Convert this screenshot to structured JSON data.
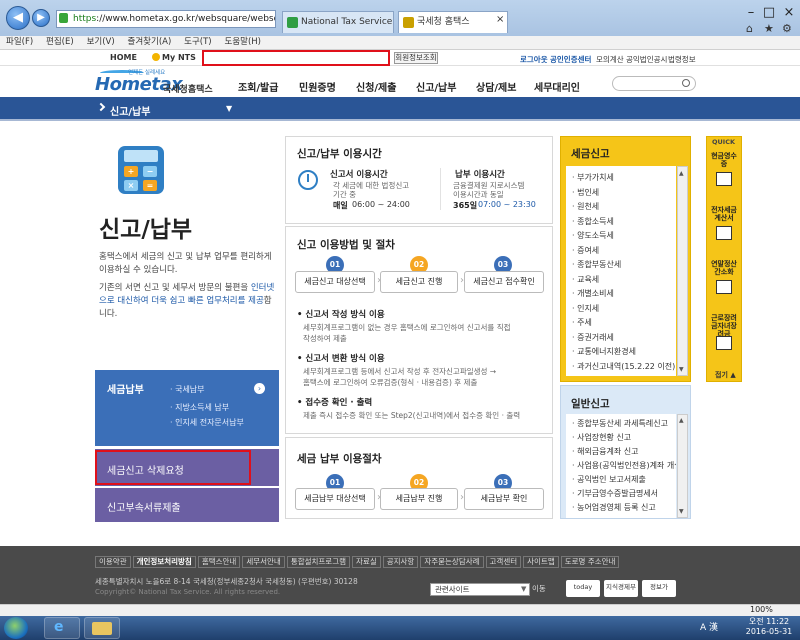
{
  "browser": {
    "url": "https://www.hometax.go.kr/websquare/websquare.wq?w2xPath=",
    "url_https": "https",
    "url_rest": "://www.hometax.go.kr/websquare/websquare.wq?w2xl",
    "tab1": "National Tax Service [KR]",
    "tab2": "국세청 홈택스",
    "menu": [
      "파일(F)",
      "편집(E)",
      "보기(V)",
      "즐겨찾기(A)",
      "도구(T)",
      "도움말(H)"
    ],
    "zoom": "100%"
  },
  "utility": {
    "home": "HOME",
    "mynts": "My NTS",
    "search_btn": "회원정보조회",
    "right": [
      "로그아웃",
      "공인인증센터",
      "모의계산",
      "공익법인공시",
      "법령정보"
    ]
  },
  "header": {
    "logo_tagline": "언제든 실례세요",
    "logo_text": "Hometax",
    "logo_korean": "국세청홈택스",
    "nav": [
      "조회/발급",
      "민원증명",
      "신청/제출",
      "신고/납부",
      "상담/제보",
      "세무대리인"
    ]
  },
  "section": {
    "title": "신고/납부",
    "caret": "▼"
  },
  "left": {
    "title": "신고/납부",
    "desc1": "홈택스에서 세금의 신고 및 납부 업무를 편리하게 이용하실 수 있습니다.",
    "desc2_a": "기존의 서면 신고 및 세무서 방문의 불편을 ",
    "desc2_b": "인터넷으로 대신하여 더욱 쉽고 빠른 업무처리를 제공",
    "desc2_c": "합니다.",
    "calc_keys": [
      "+",
      "−",
      "×",
      "="
    ],
    "menu_tax_title": "세금납부",
    "menu_tax_subs": [
      "· 국세납부",
      "· 지방소득세 납부",
      "· 인지세 전자문서납부"
    ],
    "menu_delete": "세금신고 삭제요청",
    "menu_docs": "신고부속서류제출"
  },
  "time_panel": {
    "title": "신고/납부 이용시간",
    "filing_title": "신고서 이용시간",
    "filing_desc1": "각 세금에 대한 법정신고",
    "filing_desc2": "기간 중",
    "filing_days": "매일",
    "filing_hours": "06:00 ~ 24:00",
    "pay_title": "납부 이용시간",
    "pay_desc1": "금융결제원 지로시스템",
    "pay_desc2": "이용시간과 동일",
    "pay_days": "365일",
    "pay_hours": "07:00 ~ 23:30"
  },
  "method_panel": {
    "title": "신고 이용방법 및 절차",
    "steps": [
      {
        "num": "01",
        "label": "세금신고 대상선택"
      },
      {
        "num": "02",
        "label": "세금신고 진행"
      },
      {
        "num": "03",
        "label": "세금신고 접수확인"
      }
    ],
    "m1_title": "신고서 작성 방식 이용",
    "m1_desc1": "세무회계프로그램이 없는 경우 홈택스에 로그인하여 신고서를 직접",
    "m1_desc2": "작성하여 제출",
    "m2_title": "신고서 변환 방식 이용",
    "m2_desc1": "세무회계프로그램 등에서 신고서 작성 후 전자신고파일생성 →",
    "m2_desc2": "홈택스에 로그인하여 오류검증(형식 · 내용검증) 후 제출",
    "m3_title": "접수증 확인 · 출력",
    "m3_desc1": "제출 즉시 접수증 확인 또는 Step2(신고내역)에서 접수증 확인 · 출력"
  },
  "pay_panel": {
    "title": "세금 납부 이용절차",
    "steps": [
      {
        "num": "01",
        "label": "세금납부 대상선택"
      },
      {
        "num": "02",
        "label": "세금납부 진행"
      },
      {
        "num": "03",
        "label": "세금납부 확인"
      }
    ]
  },
  "filing_list": {
    "title": "세금신고",
    "items": [
      "부가가치세",
      "법인세",
      "원천세",
      "종합소득세",
      "양도소득세",
      "증여세",
      "종합부동산세",
      "교육세",
      "개별소비세",
      "인지세",
      "주세",
      "증권거래세",
      "교통에너지환경세",
      "과거신고내역(15.2.22 이전)"
    ]
  },
  "general_list": {
    "title": "일반신고",
    "items": [
      "종합부동산세 과세특례신고",
      "사업장현황 신고",
      "해외금융계좌 신고",
      "사업용(공익법인전용)계좌 개설",
      "공익법인 보고서제출",
      "기부금영수증발급명세서",
      "농어업경영체 등록 신고"
    ]
  },
  "quick": {
    "title": "QUICK",
    "items": [
      "현금영수증",
      "전자세금계산서",
      "연말정산간소화",
      "근로장려금자녀장려금"
    ],
    "fold": "접기 ▲"
  },
  "footer": {
    "links": [
      "이용약관",
      "개인정보처리방침",
      "홈택스안내",
      "세무서안내",
      "통합설치프로그램",
      "자료실",
      "공지사항",
      "자주묻는상담사례",
      "고객센터",
      "사이트맵",
      "도로명 주소안내"
    ],
    "address": "세종특별자치시 노을6로 8-14 국세청(정부세종2청사 국세청동) (우편번호) 30128",
    "copyright": "Copyright© National Tax Service. All rights reserved.",
    "related": "관련사이트",
    "go": "이동",
    "badges": [
      "today",
      "지식경제부",
      "정보가"
    ]
  },
  "taskbar": {
    "ime": "A 漢",
    "time": "오전 11:22",
    "date": "2016-05-31"
  }
}
